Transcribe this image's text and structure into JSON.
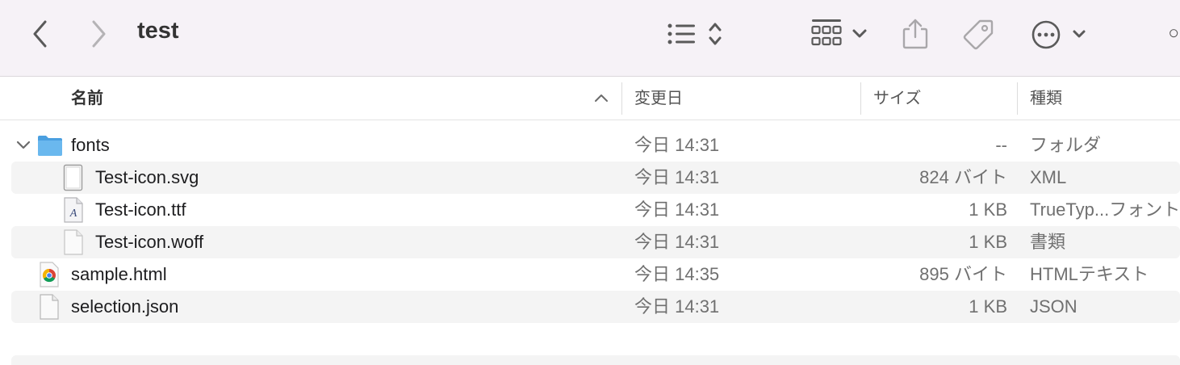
{
  "window": {
    "title": "test"
  },
  "toolbar": {
    "back_icon": "chevron-left",
    "forward_icon": "chevron-right",
    "view_icon": "list-view",
    "group_icon": "grid-view",
    "share_icon": "share",
    "tag_icon": "tag",
    "more_icon": "ellipsis-circle",
    "search_icon": "search"
  },
  "columns": {
    "name": "名前",
    "modified": "変更日",
    "size": "サイズ",
    "kind": "種類"
  },
  "files": [
    {
      "name": "fonts",
      "modified": "今日 14:31",
      "size": "--",
      "kind": "フォルダ",
      "icon": "folder-icon"
    },
    {
      "name": "Test-icon.svg",
      "modified": "今日 14:31",
      "size": "824 バイト",
      "kind": "XML",
      "icon": "svg-file-icon"
    },
    {
      "name": "Test-icon.ttf",
      "modified": "今日 14:31",
      "size": "1 KB",
      "kind": "TrueTyp...フォント",
      "icon": "font-file-icon"
    },
    {
      "name": "Test-icon.woff",
      "modified": "今日 14:31",
      "size": "1 KB",
      "kind": "書類",
      "icon": "document-icon"
    },
    {
      "name": "sample.html",
      "modified": "今日 14:35",
      "size": "895 バイト",
      "kind": "HTMLテキスト",
      "icon": "chrome-html-icon"
    },
    {
      "name": "selection.json",
      "modified": "今日 14:31",
      "size": "1 KB",
      "kind": "JSON",
      "icon": "document-icon"
    }
  ]
}
